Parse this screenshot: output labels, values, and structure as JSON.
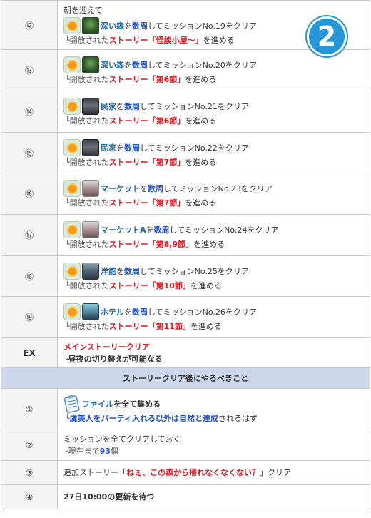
{
  "badge": "2",
  "rows": [
    {
      "num": "⑫",
      "header": "朝を迎えて",
      "icons": [
        "sun-icon",
        "forest-icon"
      ],
      "loc": "深い森",
      "o": "を",
      "cnt": "数周",
      "mission": "してミッションNo.19をクリア",
      "sub_pre": "└開放された",
      "story": "ストーリー「怪談小屋～」",
      "sub_post": "を進める"
    },
    {
      "num": "⑬",
      "icons": [
        "sun-icon",
        "forest-icon"
      ],
      "loc": "深い森",
      "o": "を",
      "cnt": "数周",
      "mission": "してミッションNo.20をクリア",
      "sub_pre": "└開放された",
      "story": "ストーリー「第6節」",
      "sub_post": "を進める"
    },
    {
      "num": "⑭",
      "icons": [
        "sun-icon",
        "house-icon"
      ],
      "loc": "民家",
      "o": "を",
      "cnt": "数周",
      "mission": "してミッションNo.21をクリア",
      "sub_pre": "└開放された",
      "story": "ストーリー「第6節」",
      "sub_post": "を進める"
    },
    {
      "num": "⑮",
      "icons": [
        "sun-icon",
        "house-icon"
      ],
      "loc": "民家",
      "o": "を",
      "cnt": "数周",
      "mission": "してミッションNo.22をクリア",
      "sub_pre": "└開放された",
      "story": "ストーリー「第7節」",
      "sub_post": "を進める"
    },
    {
      "num": "⑯",
      "icons": [
        "sun-icon",
        "market-icon"
      ],
      "loc": "マーケット",
      "o": "を",
      "cnt": "数周",
      "mission": "してミッションNo.23をクリア",
      "sub_pre": "└開放された",
      "story": "ストーリー「第7節」",
      "sub_post": "を進める"
    },
    {
      "num": "⑰",
      "icons": [
        "sun-icon",
        "market-icon"
      ],
      "loc": "マーケットA",
      "o": "を",
      "cnt": "数周",
      "mission": "してミッションNo.24をクリア",
      "sub_pre": "└開放された",
      "story": "ストーリー「第8,9節」",
      "sub_post": "を進める"
    },
    {
      "num": "⑱",
      "icons": [
        "sun-icon",
        "mansion-icon"
      ],
      "loc": "洋館",
      "o": "を",
      "cnt": "数周",
      "mission": "してミッションNo.25をクリア",
      "sub_pre": "└開放された",
      "story": "ストーリー「第10節」",
      "sub_post": "を進める"
    },
    {
      "num": "⑲",
      "icons": [
        "sun-icon",
        "hotel-icon"
      ],
      "loc": "ホテル",
      "o": "を",
      "cnt": "数周",
      "mission": "してミッションNo.26をクリア",
      "sub_pre": "└開放された",
      "story": "ストーリー「第11節」",
      "sub_post": "を進める"
    }
  ],
  "ex": {
    "num": "EX",
    "title": "メインストーリークリア",
    "sub": "└昼夜の切り替えが可能なる"
  },
  "section_header": "ストーリークリア後にやるべきこと",
  "after": [
    {
      "num": "①",
      "icon": "file-icon",
      "line1_a": "ファイル",
      "line1_b": "を全て集める",
      "line2_pre": "└",
      "line2_a": "虞美人をパーティ入れる以外は自然と達成",
      "line2_b": "されるはず"
    },
    {
      "num": "②",
      "line1": "ミッションを全てクリアしておく",
      "line2_pre": "└現在まで",
      "line2_num": "93",
      "line2_post": "個"
    },
    {
      "num": "③",
      "line1_a": "追加ストーリー「",
      "line1_b": "ねぇ、この森から帰れなくなくない？",
      "line1_c": "」クリア"
    },
    {
      "num": "④",
      "line1": "27日10:00の更新を待つ"
    }
  ]
}
